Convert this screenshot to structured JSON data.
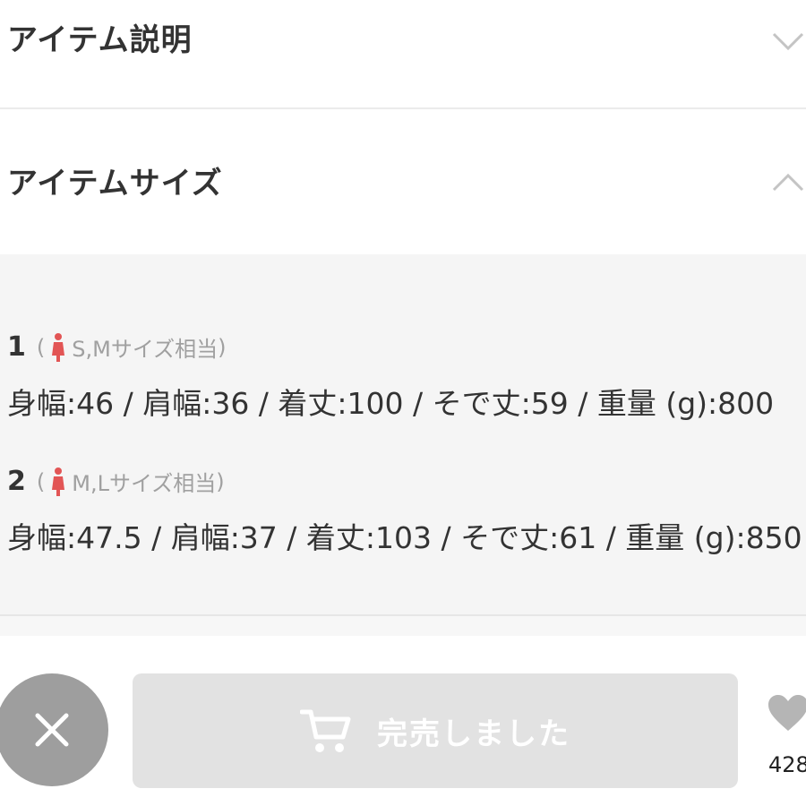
{
  "sections": {
    "description": {
      "title": "アイテム説明",
      "state": "collapsed"
    },
    "size": {
      "title": "アイテムサイズ",
      "state": "expanded"
    }
  },
  "sizes": [
    {
      "number": "1",
      "open_paren": "(",
      "label": "S,Mサイズ相当",
      "close_paren": ")",
      "measurements": "身幅:46 / 肩幅:36 / 着丈:100 / そで丈:59 / 重量 (g):800"
    },
    {
      "number": "2",
      "open_paren": "(",
      "label": "M,Lサイズ相当",
      "close_paren": ")",
      "measurements": "身幅:47.5 / 肩幅:37 / 着丈:103 / そで丈:61 / 重量 (g):850"
    }
  ],
  "actions": {
    "close_icon": "close-icon",
    "soldout_label": "完売しました",
    "cart_icon": "cart-icon",
    "favorite_icon": "heart-icon",
    "favorite_count": "428"
  },
  "colors": {
    "model_icon": "#e25555",
    "close_button": "#9e9e9e",
    "soldout_button": "#e2e2e2",
    "heart": "#b5b5b5"
  }
}
